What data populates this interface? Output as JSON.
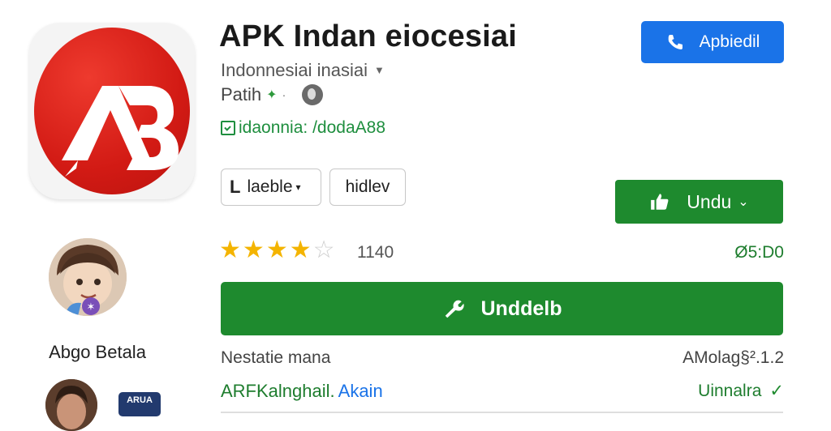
{
  "app": {
    "title": "APK Indan eiocesiai",
    "developer": "Indonnesiai inasiai",
    "path_label": "Patih",
    "contains_ads": "idaonnia: /dodaA88",
    "icon_letters": "AB"
  },
  "chips": [
    {
      "label": "laeble"
    },
    {
      "label": "hidlev"
    }
  ],
  "buttons": {
    "top_right": "Apbiedil",
    "secondary_green": "Undu",
    "primary_green": "Unddelb"
  },
  "rating": {
    "stars_filled": 4,
    "stars_total": 5,
    "review_count": "1140"
  },
  "price": "Ø5:D0",
  "info": {
    "row1_left": "Nestatie mana",
    "row1_right": "AMolag§².1.2",
    "row2_left": "ARFKalnghail.",
    "row2_left_link": "Akain",
    "row2_right": "Uinnalra"
  },
  "sidebar": {
    "developer_name": "Abgo Betala",
    "badge_text": "ARUA"
  },
  "colors": {
    "primary_green": "#1e8a2e",
    "accent_blue": "#1a73e8",
    "icon_red": "#d21a14",
    "star": "#f4b400"
  },
  "icons": [
    "phone-icon",
    "thumbs-up-icon",
    "wrench-icon",
    "globe-icon",
    "check-icon",
    "leaf-icon",
    "ads-box-icon"
  ]
}
